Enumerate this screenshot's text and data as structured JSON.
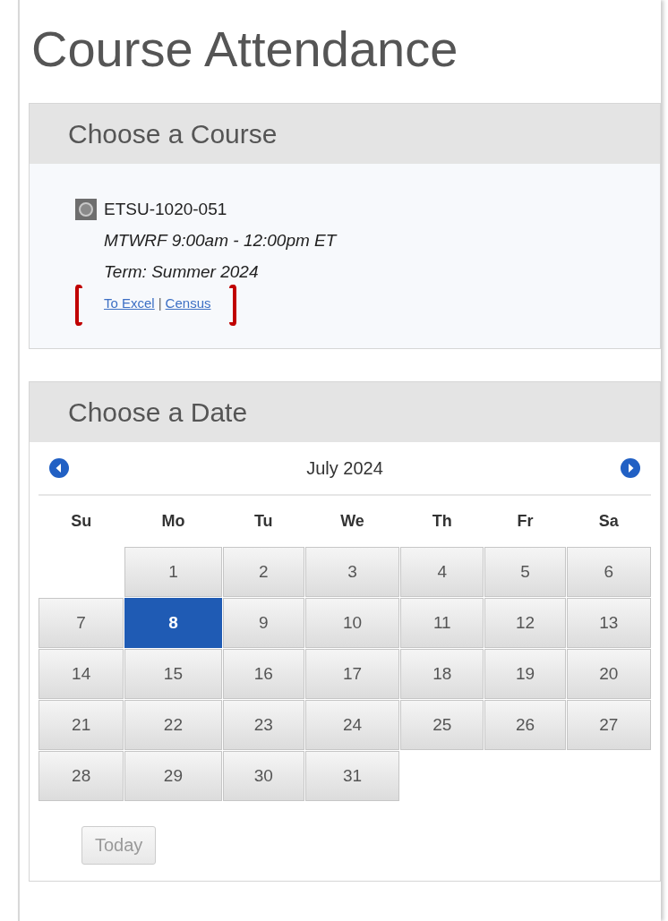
{
  "page": {
    "title": "Course Attendance"
  },
  "course_panel": {
    "heading": "Choose a Course",
    "course": {
      "code": "ETSU-1020-051",
      "schedule": "MTWRF 9:00am - 12:00pm ET",
      "term": "Term: Summer 2024",
      "links": [
        "To Excel",
        "Census"
      ],
      "separator": "|"
    }
  },
  "date_panel": {
    "heading": "Choose a Date",
    "month": "July 2024",
    "weekdays": [
      "Su",
      "Mo",
      "Tu",
      "We",
      "Th",
      "Fr",
      "Sa"
    ],
    "weeks": [
      [
        {
          "kind": "blank"
        },
        {
          "label": "1",
          "selected": false
        },
        {
          "label": "2",
          "selected": false
        },
        {
          "label": "3",
          "selected": false
        },
        {
          "label": "4",
          "selected": false
        },
        {
          "label": "5",
          "selected": false
        },
        {
          "label": "6",
          "selected": false
        }
      ],
      [
        {
          "label": "7",
          "selected": false
        },
        {
          "label": "8",
          "selected": true
        },
        {
          "label": "9",
          "selected": false
        },
        {
          "label": "10",
          "selected": false
        },
        {
          "label": "11",
          "selected": false
        },
        {
          "label": "12",
          "selected": false
        },
        {
          "label": "13",
          "selected": false
        }
      ],
      [
        {
          "label": "14",
          "selected": false
        },
        {
          "label": "15",
          "selected": false
        },
        {
          "label": "16",
          "selected": false
        },
        {
          "label": "17",
          "selected": false
        },
        {
          "label": "18",
          "selected": false
        },
        {
          "label": "19",
          "selected": false
        },
        {
          "label": "20",
          "selected": false
        }
      ],
      [
        {
          "label": "21",
          "selected": false
        },
        {
          "label": "22",
          "selected": false
        },
        {
          "label": "23",
          "selected": false
        },
        {
          "label": "24",
          "selected": false
        },
        {
          "label": "25",
          "selected": false
        },
        {
          "label": "26",
          "selected": false
        },
        {
          "label": "27",
          "selected": false
        }
      ],
      [
        {
          "label": "28",
          "selected": false
        },
        {
          "label": "29",
          "selected": false
        },
        {
          "label": "30",
          "selected": false
        },
        {
          "label": "31",
          "selected": false
        },
        {
          "kind": "blank"
        },
        {
          "kind": "blank"
        },
        {
          "kind": "blank"
        }
      ]
    ],
    "today_button": {
      "label": "Today",
      "disabled": true
    }
  }
}
